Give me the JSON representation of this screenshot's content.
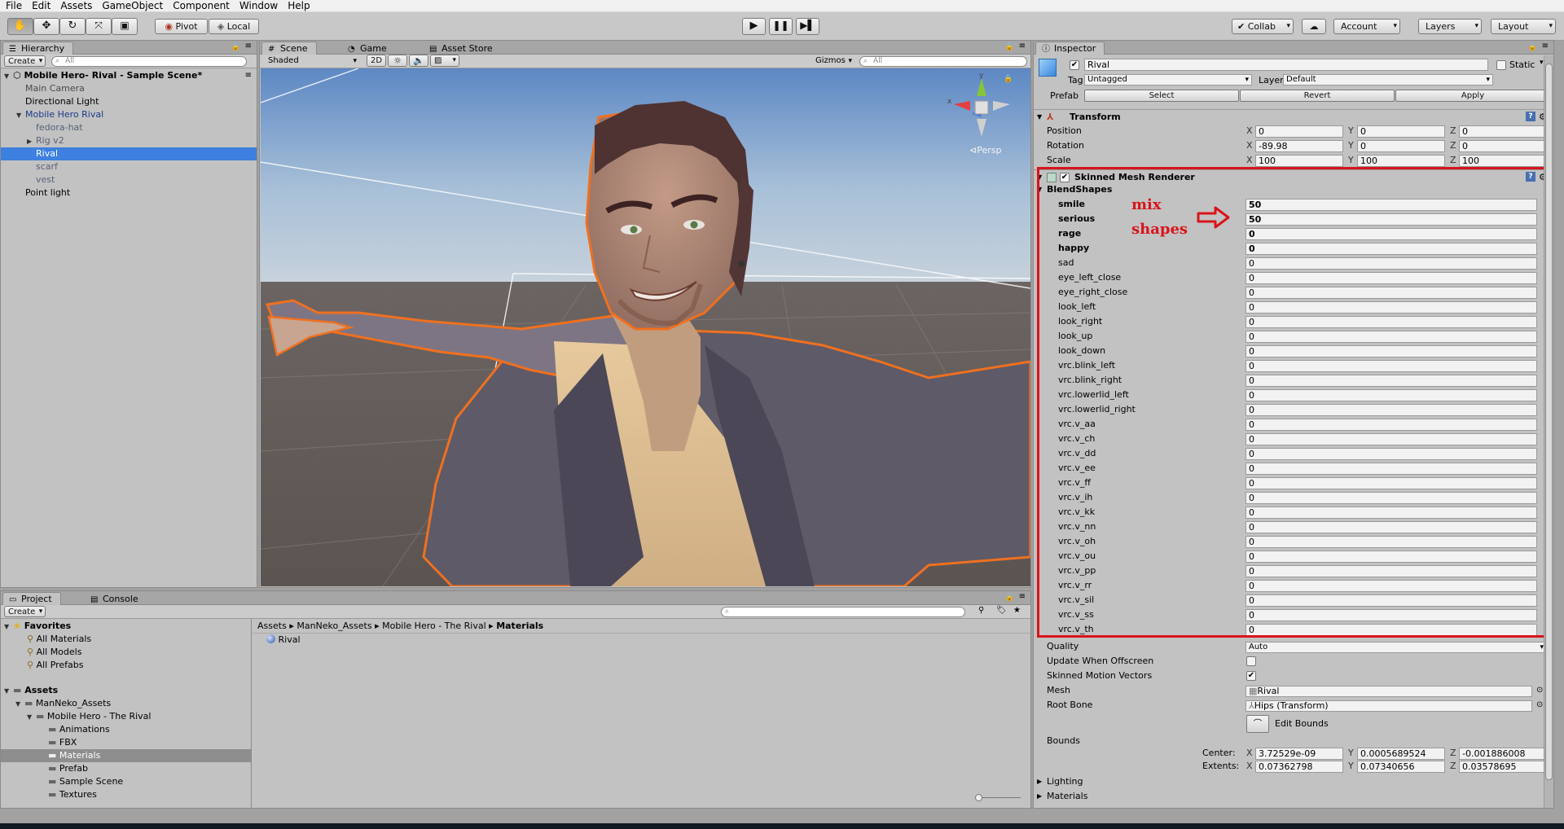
{
  "menu": [
    "File",
    "Edit",
    "Assets",
    "GameObject",
    "Component",
    "Window",
    "Help"
  ],
  "toolbar": {
    "pivot": "Pivot",
    "local": "Local",
    "collab": "Collab",
    "account": "Account",
    "layers": "Layers",
    "layout": "Layout"
  },
  "hierarchy": {
    "tab": "Hierarchy",
    "create": "Create",
    "search_placeholder": "All",
    "scene": "Mobile Hero- Rival - Sample Scene*",
    "items": [
      {
        "label": "Main Camera",
        "indent": 1
      },
      {
        "label": "Directional Light",
        "indent": 1
      },
      {
        "label": "Mobile Hero Rival",
        "indent": 1
      },
      {
        "label": "fedora-hat",
        "indent": 2
      },
      {
        "label": "Rig v2",
        "indent": 2
      },
      {
        "label": "Rival",
        "indent": 2
      },
      {
        "label": "scarf",
        "indent": 2
      },
      {
        "label": "vest",
        "indent": 2
      },
      {
        "label": "Point light",
        "indent": 1
      }
    ]
  },
  "scene": {
    "tabs": [
      "Scene",
      "Game",
      "Asset Store"
    ],
    "shading": "Shaded",
    "mode_2d": "2D",
    "gizmos": "Gizmos",
    "search_placeholder": "All",
    "persp": "Persp",
    "gizmo_y": "y",
    "gizmo_x": "x"
  },
  "inspector": {
    "tab": "Inspector",
    "name": "Rival",
    "static": "Static",
    "tag_label": "Tag",
    "tag": "Untagged",
    "layer_label": "Layer",
    "layer": "Default",
    "prefab_label": "Prefab",
    "prefab_select": "Select",
    "prefab_revert": "Revert",
    "prefab_apply": "Apply",
    "transform": {
      "title": "Transform",
      "rows": [
        {
          "label": "Position",
          "x": "0",
          "y": "0",
          "z": "0"
        },
        {
          "label": "Rotation",
          "x": "-89.98",
          "y": "0",
          "z": "0"
        },
        {
          "label": "Scale",
          "x": "100",
          "y": "100",
          "z": "100"
        }
      ]
    },
    "smr": {
      "title": "Skinned Mesh Renderer",
      "blendshapes_label": "BlendShapes",
      "annotation_line1": "mix",
      "annotation_line2": "shapes",
      "blendshapes": [
        {
          "name": "smile",
          "value": "50",
          "bold": true
        },
        {
          "name": "serious",
          "value": "50",
          "bold": true
        },
        {
          "name": "rage",
          "value": "0",
          "bold": true
        },
        {
          "name": "happy",
          "value": "0",
          "bold": true
        },
        {
          "name": "sad",
          "value": "0"
        },
        {
          "name": "eye_left_close",
          "value": "0"
        },
        {
          "name": "eye_right_close",
          "value": "0"
        },
        {
          "name": "look_left",
          "value": "0"
        },
        {
          "name": "look_right",
          "value": "0"
        },
        {
          "name": "look_up",
          "value": "0"
        },
        {
          "name": "look_down",
          "value": "0"
        },
        {
          "name": "vrc.blink_left",
          "value": "0"
        },
        {
          "name": "vrc.blink_right",
          "value": "0"
        },
        {
          "name": "vrc.lowerlid_left",
          "value": "0"
        },
        {
          "name": "vrc.lowerlid_right",
          "value": "0"
        },
        {
          "name": "vrc.v_aa",
          "value": "0"
        },
        {
          "name": "vrc.v_ch",
          "value": "0"
        },
        {
          "name": "vrc.v_dd",
          "value": "0"
        },
        {
          "name": "vrc.v_ee",
          "value": "0"
        },
        {
          "name": "vrc.v_ff",
          "value": "0"
        },
        {
          "name": "vrc.v_ih",
          "value": "0"
        },
        {
          "name": "vrc.v_kk",
          "value": "0"
        },
        {
          "name": "vrc.v_nn",
          "value": "0"
        },
        {
          "name": "vrc.v_oh",
          "value": "0"
        },
        {
          "name": "vrc.v_ou",
          "value": "0"
        },
        {
          "name": "vrc.v_pp",
          "value": "0"
        },
        {
          "name": "vrc.v_rr",
          "value": "0"
        },
        {
          "name": "vrc.v_sil",
          "value": "0"
        },
        {
          "name": "vrc.v_ss",
          "value": "0"
        },
        {
          "name": "vrc.v_th",
          "value": "0"
        }
      ],
      "quality_label": "Quality",
      "quality": "Auto",
      "update_offscreen_label": "Update When Offscreen",
      "motion_vectors_label": "Skinned Motion Vectors",
      "mesh_label": "Mesh",
      "mesh": "Rival",
      "root_bone_label": "Root Bone",
      "root_bone": "Hips (Transform)",
      "edit_bounds": "Edit Bounds",
      "bounds_label": "Bounds",
      "center_label": "Center:",
      "center": {
        "x": "3.72529e-09",
        "y": "0.0005689524",
        "z": "-0.001886008"
      },
      "extents_label": "Extents:",
      "extents": {
        "x": "0.07362798",
        "y": "0.07340656",
        "z": "0.03578695"
      },
      "lighting": "Lighting",
      "materials": "Materials"
    }
  },
  "project": {
    "tabs": [
      "Project",
      "Console"
    ],
    "create": "Create",
    "favorites": "Favorites",
    "fav_items": [
      "All Materials",
      "All Models",
      "All Prefabs"
    ],
    "assets": "Assets",
    "tree": [
      {
        "label": "ManNeko_Assets",
        "indent": 1
      },
      {
        "label": "Mobile Hero - The Rival",
        "indent": 2
      },
      {
        "label": "Animations",
        "indent": 3
      },
      {
        "label": "FBX",
        "indent": 3
      },
      {
        "label": "Materials",
        "indent": 3
      },
      {
        "label": "Prefab",
        "indent": 3
      },
      {
        "label": "Sample Scene",
        "indent": 3
      },
      {
        "label": "Textures",
        "indent": 3
      }
    ],
    "breadcrumb": [
      "Assets",
      "ManNeko_Assets",
      "Mobile Hero - The Rival",
      "Materials"
    ],
    "files": [
      "Rival"
    ]
  },
  "colors": {
    "accent_selection": "#3d80df",
    "annotation_red": "#d9141b",
    "prefab_blue": "#1b3a8c"
  }
}
